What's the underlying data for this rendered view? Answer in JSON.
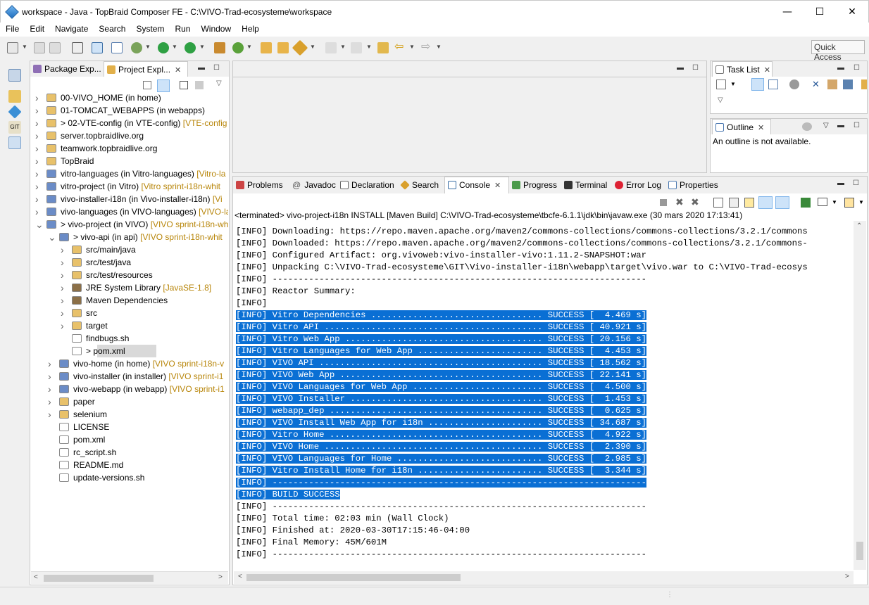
{
  "window": {
    "title": "workspace - Java - TopBraid Composer FE - C:\\VIVO-Trad-ecosysteme\\workspace",
    "minimize": "—",
    "maximize": "☐",
    "close": "✕"
  },
  "menu": [
    "File",
    "Edit",
    "Navigate",
    "Search",
    "System",
    "Run",
    "Window",
    "Help"
  ],
  "toolbar": {
    "quick_access": "Quick Access"
  },
  "left_panel": {
    "tabs": [
      {
        "label": "Package Exp..."
      },
      {
        "label": "Project Expl...",
        "active": true
      }
    ],
    "tree": [
      {
        "level": 0,
        "arrow": ">",
        "icon": "folder-icon",
        "label": "00-VIVO_HOME (in home)",
        "deco": ""
      },
      {
        "level": 0,
        "arrow": ">",
        "icon": "folder-icon",
        "label": "01-TOMCAT_WEBAPPS (in webapps)",
        "deco": ""
      },
      {
        "level": 0,
        "arrow": ">",
        "icon": "folder-icon",
        "label": "> 02-VTE-config (in VTE-config)",
        "deco": "[VTE-config"
      },
      {
        "level": 0,
        "arrow": ">",
        "icon": "folder-icon",
        "label": "server.topbraidlive.org",
        "deco": ""
      },
      {
        "level": 0,
        "arrow": ">",
        "icon": "folder-icon",
        "label": "teamwork.topbraidlive.org",
        "deco": ""
      },
      {
        "level": 0,
        "arrow": ">",
        "icon": "folder-icon",
        "label": "TopBraid",
        "deco": ""
      },
      {
        "level": 0,
        "arrow": ">",
        "icon": "project-icon",
        "label": "vitro-languages (in Vitro-languages)",
        "deco": "[Vitro-la"
      },
      {
        "level": 0,
        "arrow": ">",
        "icon": "project-icon",
        "label": "vitro-project (in Vitro)",
        "deco": "[Vitro sprint-i18n-whit"
      },
      {
        "level": 0,
        "arrow": ">",
        "icon": "project-icon",
        "label": "vivo-installer-i18n (in Vivo-installer-i18n)",
        "deco": "[Vi"
      },
      {
        "level": 0,
        "arrow": ">",
        "icon": "project-icon",
        "label": "vivo-languages (in VIVO-languages)",
        "deco": "[VIVO-la"
      },
      {
        "level": 0,
        "arrow": "v",
        "icon": "project-icon",
        "label": "> vivo-project (in VIVO)",
        "deco": "[VIVO sprint-i18n-wh"
      },
      {
        "level": 1,
        "arrow": "v",
        "icon": "project-icon",
        "label": "> vivo-api (in api)",
        "deco": "[VIVO sprint-i18n-whit"
      },
      {
        "level": 2,
        "arrow": ">",
        "icon": "package-folder-icon",
        "label": "src/main/java",
        "deco": ""
      },
      {
        "level": 2,
        "arrow": ">",
        "icon": "package-folder-icon",
        "label": "src/test/java",
        "deco": ""
      },
      {
        "level": 2,
        "arrow": ">",
        "icon": "package-folder-icon",
        "label": "src/test/resources",
        "deco": ""
      },
      {
        "level": 2,
        "arrow": ">",
        "icon": "library-icon",
        "label": "JRE System Library",
        "deco": "[JavaSE-1.8]"
      },
      {
        "level": 2,
        "arrow": ">",
        "icon": "library-icon",
        "label": "Maven Dependencies",
        "deco": ""
      },
      {
        "level": 2,
        "arrow": ">",
        "icon": "folder-icon",
        "label": "src",
        "deco": ""
      },
      {
        "level": 2,
        "arrow": ">",
        "icon": "folder-icon",
        "label": "target",
        "deco": ""
      },
      {
        "level": 2,
        "arrow": "",
        "icon": "file-icon",
        "label": "findbugs.sh",
        "deco": ""
      },
      {
        "level": 2,
        "arrow": "",
        "icon": "xml-file-icon",
        "label": "> pom.xml",
        "deco": "",
        "selected": true
      },
      {
        "level": 1,
        "arrow": ">",
        "icon": "project-icon",
        "label": "vivo-home (in home)",
        "deco": "[VIVO sprint-i18n-v"
      },
      {
        "level": 1,
        "arrow": ">",
        "icon": "project-icon",
        "label": "vivo-installer (in installer)",
        "deco": "[VIVO sprint-i1"
      },
      {
        "level": 1,
        "arrow": ">",
        "icon": "project-icon",
        "label": "vivo-webapp (in webapp)",
        "deco": "[VIVO sprint-i1"
      },
      {
        "level": 1,
        "arrow": ">",
        "icon": "folder-icon",
        "label": "paper",
        "deco": ""
      },
      {
        "level": 1,
        "arrow": ">",
        "icon": "folder-icon",
        "label": "selenium",
        "deco": ""
      },
      {
        "level": 1,
        "arrow": "",
        "icon": "file-icon",
        "label": "LICENSE",
        "deco": ""
      },
      {
        "level": 1,
        "arrow": "",
        "icon": "file-icon",
        "label": "pom.xml",
        "deco": ""
      },
      {
        "level": 1,
        "arrow": "",
        "icon": "file-icon",
        "label": "rc_script.sh",
        "deco": ""
      },
      {
        "level": 1,
        "arrow": "",
        "icon": "file-icon",
        "label": "README.md",
        "deco": ""
      },
      {
        "level": 1,
        "arrow": "",
        "icon": "file-icon",
        "label": "update-versions.sh",
        "deco": ""
      }
    ]
  },
  "right_top": {
    "task_list_tab": "Task List"
  },
  "outline": {
    "tab": "Outline",
    "message": "An outline is not available."
  },
  "bottom_tabs": [
    "Problems",
    "Javadoc",
    "Declaration",
    "Search",
    "Console",
    "Progress",
    "Terminal",
    "Error Log",
    "Properties"
  ],
  "console": {
    "header": "<terminated> vivo-project-i18n INSTALL [Maven Build] C:\\VIVO-Trad-ecosysteme\\tbcfe-6.1.1\\jdk\\bin\\javaw.exe (30 mars 2020 17:13:41)",
    "lines": [
      {
        "text": "[INFO] Downloading: https://repo.maven.apache.org/maven2/commons-collections/commons-collections/3.2.1/commons",
        "sel": false
      },
      {
        "text": "[INFO] Downloaded: https://repo.maven.apache.org/maven2/commons-collections/commons-collections/3.2.1/commons-",
        "sel": false
      },
      {
        "text": "[INFO] Configured Artifact: org.vivoweb:vivo-installer-vivo:1.11.2-SNAPSHOT:war",
        "sel": false
      },
      {
        "text": "[INFO] Unpacking C:\\VIVO-Trad-ecosysteme\\GIT\\Vivo-installer-i18n\\webapp\\target\\vivo.war to C:\\VIVO-Trad-ecosys",
        "sel": false
      },
      {
        "text": "[INFO] ------------------------------------------------------------------------",
        "sel": false
      },
      {
        "text": "[INFO] Reactor Summary:",
        "sel": false
      },
      {
        "text": "[INFO]",
        "sel": false
      },
      {
        "text": "[INFO] Vitro Dependencies ................................. SUCCESS [  4.469 s]",
        "sel": true
      },
      {
        "text": "[INFO] Vitro API .......................................... SUCCESS [ 40.921 s]",
        "sel": true
      },
      {
        "text": "[INFO] Vitro Web App ...................................... SUCCESS [ 20.156 s]",
        "sel": true
      },
      {
        "text": "[INFO] Vitro Languages for Web App ........................ SUCCESS [  4.453 s]",
        "sel": true
      },
      {
        "text": "[INFO] VIVO API ........................................... SUCCESS [ 18.562 s]",
        "sel": true
      },
      {
        "text": "[INFO] VIVO Web App ....................................... SUCCESS [ 22.141 s]",
        "sel": true
      },
      {
        "text": "[INFO] VIVO Languages for Web App ......................... SUCCESS [  4.500 s]",
        "sel": true
      },
      {
        "text": "[INFO] VIVO Installer ..................................... SUCCESS [  1.453 s]",
        "sel": true
      },
      {
        "text": "[INFO] webapp_dep ......................................... SUCCESS [  0.625 s]",
        "sel": true
      },
      {
        "text": "[INFO] VIVO Install Web App for i18n ...................... SUCCESS [ 34.687 s]",
        "sel": true
      },
      {
        "text": "[INFO] Vitro Home ......................................... SUCCESS [  4.922 s]",
        "sel": true
      },
      {
        "text": "[INFO] VIVO Home .......................................... SUCCESS [  2.390 s]",
        "sel": true
      },
      {
        "text": "[INFO] VIVO Languages for Home ............................ SUCCESS [  2.985 s]",
        "sel": true
      },
      {
        "text": "[INFO] Vitro Install Home for i18n ........................ SUCCESS [  3.344 s]",
        "sel": true
      },
      {
        "text": "[INFO] ------------------------------------------------------------------------",
        "sel": true
      },
      {
        "text": "[INFO] BUILD SUCCESS",
        "sel": true
      },
      {
        "text": "[INFO] ------------------------------------------------------------------------",
        "sel": false
      },
      {
        "text": "[INFO] Total time: 02:03 min (Wall Clock)",
        "sel": false
      },
      {
        "text": "[INFO] Finished at: 2020-03-30T17:15:46-04:00",
        "sel": false
      },
      {
        "text": "[INFO] Final Memory: 45M/601M",
        "sel": false
      },
      {
        "text": "[INFO] ------------------------------------------------------------------------",
        "sel": false
      }
    ]
  }
}
